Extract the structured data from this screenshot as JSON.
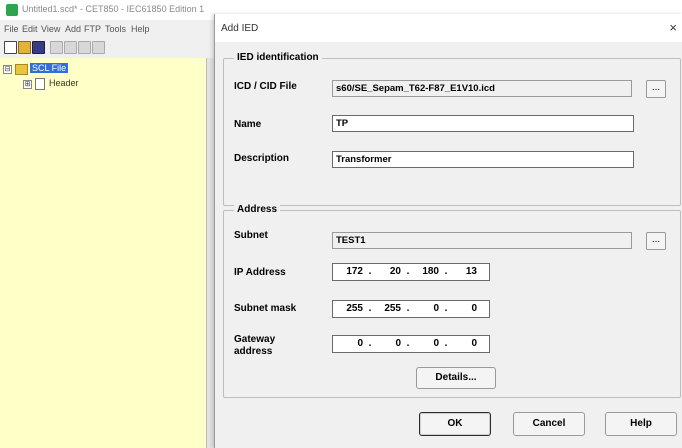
{
  "app": {
    "window_title": "Untitled1.scd* - CET850 - IEC61850 Edition 1",
    "menu": [
      "File",
      "Edit",
      "View",
      "Add",
      "FTP",
      "Tools",
      "Help"
    ],
    "tree": {
      "root_label": "SCL File",
      "child_label": "Header",
      "root_expander": "⊟",
      "child_expander": "⊞"
    }
  },
  "dialog": {
    "title": "Add IED",
    "close_glyph": "×",
    "ied_identification": {
      "group_title": "IED identification",
      "icd_label": "ICD / CID File",
      "icd_value": "s60/SE_Sepam_T62-F87_E1V10.icd",
      "browse_label": "...",
      "name_label": "Name",
      "name_value": "TP",
      "description_label": "Description",
      "description_value": "Transformer"
    },
    "address": {
      "group_title": "Address",
      "subnet_label": "Subnet",
      "subnet_value": "TEST1",
      "browse_label": "...",
      "ip_label": "IP Address",
      "ip": [
        "172",
        "20",
        "180",
        "13"
      ],
      "mask_label": "Subnet mask",
      "mask": [
        "255",
        "255",
        "0",
        "0"
      ],
      "gateway_label": "Gateway address",
      "gateway": [
        "0",
        "0",
        "0",
        "0"
      ],
      "dot": ".",
      "details_label": "Details..."
    },
    "buttons": {
      "ok": "OK",
      "cancel": "Cancel",
      "help": "Help"
    }
  }
}
